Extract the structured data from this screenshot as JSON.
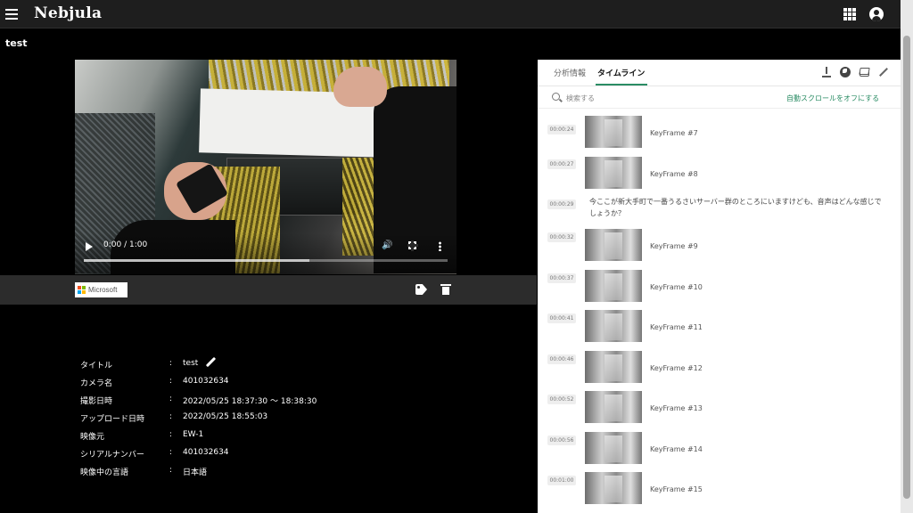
{
  "app": {
    "brand": "Nebjula"
  },
  "page": {
    "title": "test"
  },
  "video": {
    "time": "0:00 / 1:00",
    "buffered_fraction": 0.62
  },
  "actions": {
    "provider": "Microsoft"
  },
  "meta": [
    {
      "label": "タイトル",
      "value": "test"
    },
    {
      "label": "カメラ名",
      "value": "401032634"
    },
    {
      "label": "撮影日時",
      "value": "2022/05/25 18:37:30 ～ 18:38:30"
    },
    {
      "label": "アップロード日時",
      "value": "2022/05/25 18:55:03"
    },
    {
      "label": "映像元",
      "value": "EW-1"
    },
    {
      "label": "シリアルナンバー",
      "value": "401032634"
    },
    {
      "label": "映像中の言語",
      "value": "日本語"
    }
  ],
  "meta_colon": ":",
  "panel": {
    "tabs": [
      "分析情報",
      "タイムライン"
    ],
    "active_tab": "タイムライン",
    "search_placeholder": "検索する",
    "autoscroll_label": "自動スクロールをオフにする",
    "items": [
      {
        "time": "00:00:24",
        "type": "keyframe",
        "label": "KeyFrame #7"
      },
      {
        "time": "00:00:27",
        "type": "keyframe",
        "label": "KeyFrame #8"
      },
      {
        "time": "00:00:29",
        "type": "speech",
        "text": "今ここが新大手町で一番うるさいサーバー群のところにいますけども、音声はどんな感じでしょうか？"
      },
      {
        "time": "00:00:32",
        "type": "keyframe",
        "label": "KeyFrame #9"
      },
      {
        "time": "00:00:37",
        "type": "keyframe",
        "label": "KeyFrame #10"
      },
      {
        "time": "00:00:41",
        "type": "keyframe",
        "label": "KeyFrame #11"
      },
      {
        "time": "00:00:46",
        "type": "keyframe",
        "label": "KeyFrame #12"
      },
      {
        "time": "00:00:52",
        "type": "keyframe",
        "label": "KeyFrame #13"
      },
      {
        "time": "00:00:56",
        "type": "keyframe",
        "label": "KeyFrame #14"
      },
      {
        "time": "00:01:00",
        "type": "keyframe",
        "label": "KeyFrame #15"
      }
    ]
  },
  "icons": {
    "menu": "menu-icon",
    "apps": "apps-grid-icon",
    "account": "account-icon",
    "play": "play-icon",
    "volume": "volume-icon",
    "fullscreen": "fullscreen-icon",
    "more": "more-vert-icon",
    "tag": "tag-icon",
    "delete": "trash-icon",
    "edit": "pencil-icon",
    "download": "download-icon",
    "globe": "globe-icon",
    "layers": "layers-icon",
    "search": "search-icon"
  },
  "colors": {
    "accent": "#2a8c64",
    "topbar": "#1e1e1e",
    "actionbar": "#2c2c2c"
  }
}
